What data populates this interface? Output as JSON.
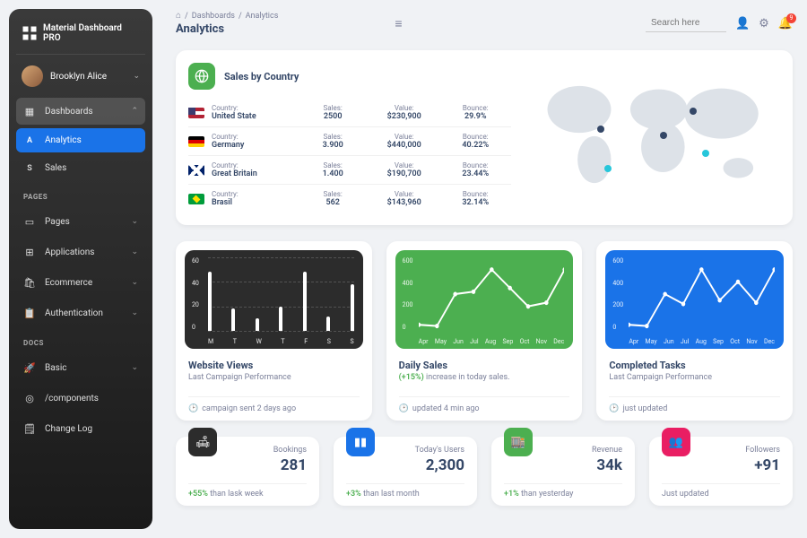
{
  "brand": "Material Dashboard PRO",
  "user": {
    "name": "Brooklyn Alice"
  },
  "nav": {
    "dashboards": "Dashboards",
    "analytics": "Analytics",
    "sales": "Sales",
    "section_pages": "PAGES",
    "pages": "Pages",
    "applications": "Applications",
    "ecommerce": "Ecommerce",
    "authentication": "Authentication",
    "section_docs": "DOCS",
    "basic": "Basic",
    "components": "/components",
    "changelog": "Change Log"
  },
  "breadcrumb": {
    "root": "Dashboards",
    "current": "Analytics"
  },
  "page_title": "Analytics",
  "search_placeholder": "Search here",
  "notif_count": "9",
  "country_card": {
    "title": "Sales by Country",
    "columns": {
      "country": "Country:",
      "sales": "Sales:",
      "value": "Value:",
      "bounce": "Bounce:"
    },
    "rows": [
      {
        "country": "United State",
        "sales": "2500",
        "value": "$230,900",
        "bounce": "29.9%",
        "flag": "us"
      },
      {
        "country": "Germany",
        "sales": "3.900",
        "value": "$440,000",
        "bounce": "40.22%",
        "flag": "de"
      },
      {
        "country": "Great Britain",
        "sales": "1.400",
        "value": "$190,700",
        "bounce": "23.44%",
        "flag": "gb"
      },
      {
        "country": "Brasil",
        "sales": "562",
        "value": "$143,960",
        "bounce": "32.14%",
        "flag": "br"
      }
    ]
  },
  "charts": {
    "views": {
      "title": "Website Views",
      "sub": "Last Campaign Performance",
      "footer": "campaign sent 2 days ago"
    },
    "daily": {
      "title": "Daily Sales",
      "sub_bold": "(+15%)",
      "sub_rest": " increase in today sales.",
      "footer": "updated 4 min ago"
    },
    "tasks": {
      "title": "Completed Tasks",
      "sub": "Last Campaign Performance",
      "footer": "just updated"
    }
  },
  "stats": {
    "bookings": {
      "label": "Bookings",
      "value": "281",
      "delta": "+55%",
      "rest": " than lask week"
    },
    "users": {
      "label": "Today's Users",
      "value": "2,300",
      "delta": "+3%",
      "rest": " than last month"
    },
    "revenue": {
      "label": "Revenue",
      "value": "34k",
      "delta": "+1%",
      "rest": " than yesterday"
    },
    "followers": {
      "label": "Followers",
      "value": "+91",
      "footer": "Just updated"
    }
  },
  "chart_data": [
    {
      "id": "website_views",
      "type": "bar",
      "title": "Website Views",
      "categories": [
        "M",
        "T",
        "W",
        "T",
        "F",
        "S",
        "S"
      ],
      "values": [
        48,
        18,
        10,
        20,
        48,
        12,
        38
      ],
      "ylim": [
        0,
        60
      ],
      "yticks": [
        0,
        20,
        40,
        60
      ],
      "ylabel": "",
      "xlabel": ""
    },
    {
      "id": "daily_sales",
      "type": "line",
      "title": "Daily Sales",
      "categories": [
        "Apr",
        "May",
        "Jun",
        "Jul",
        "Aug",
        "Sep",
        "Oct",
        "Nov",
        "Dec"
      ],
      "values": [
        50,
        40,
        300,
        320,
        500,
        350,
        200,
        230,
        500
      ],
      "ylim": [
        0,
        600
      ],
      "yticks": [
        0,
        200,
        400,
        600
      ],
      "ylabel": "",
      "xlabel": ""
    },
    {
      "id": "completed_tasks",
      "type": "line",
      "title": "Completed Tasks",
      "categories": [
        "Apr",
        "May",
        "Jun",
        "Jul",
        "Aug",
        "Sep",
        "Oct",
        "Nov",
        "Dec"
      ],
      "values": [
        50,
        40,
        300,
        220,
        500,
        250,
        400,
        230,
        500
      ],
      "ylim": [
        0,
        600
      ],
      "yticks": [
        0,
        200,
        400,
        600
      ],
      "ylabel": "",
      "xlabel": ""
    }
  ]
}
